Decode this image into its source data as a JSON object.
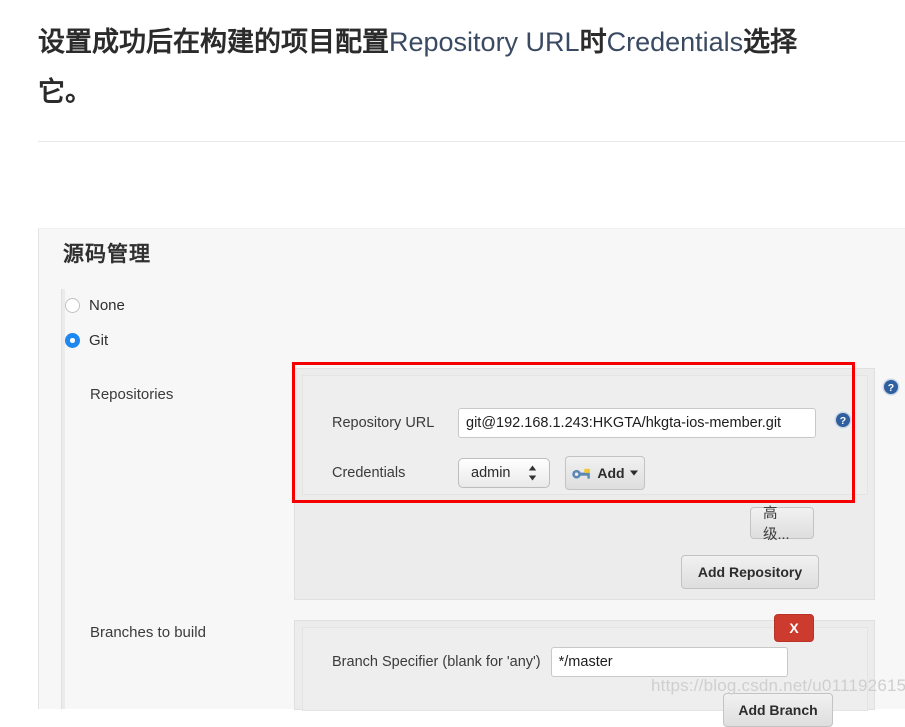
{
  "article": {
    "heading_line1_cn_a": "设置成功后在构建的项目配置",
    "heading_line1_en_a": "Repository URL",
    "heading_line1_cn_b": "时",
    "heading_line1_en_b": "Credentials",
    "heading_line1_cn_c": "选择",
    "heading_line2": "它。"
  },
  "panel": {
    "title": "源码管理",
    "scm_options": [
      {
        "label": "None",
        "selected": false
      },
      {
        "label": "Git",
        "selected": true
      }
    ],
    "repositories": {
      "section_label": "Repositories",
      "repository_url": {
        "label": "Repository URL",
        "value": "git@192.168.1.243:HKGTA/hkgta-ios-member.git",
        "help_icon": "help-icon"
      },
      "credentials": {
        "label": "Credentials",
        "selected": "admin",
        "add_button": "Add",
        "add_button_icon": "key-icon",
        "add_button_caret": "chevron-down-icon"
      },
      "advanced_button": "高级...",
      "add_repository_button": "Add Repository",
      "help_icon": "help-icon"
    },
    "branches": {
      "section_label": "Branches to build",
      "branch_specifier": {
        "label": "Branch Specifier (blank for 'any')",
        "value": "*/master",
        "help_icon": "help-icon"
      },
      "delete_button": "X",
      "add_branch_button": "Add Branch"
    }
  },
  "watermark": "https://blog.csdn.net/u011192615",
  "colors": {
    "highlight_red": "#f40000",
    "delete_red": "#cc3b2e",
    "radio_blue": "#1e88f0",
    "panel_bg": "#f7f7f7",
    "block_bg": "#ececec"
  }
}
